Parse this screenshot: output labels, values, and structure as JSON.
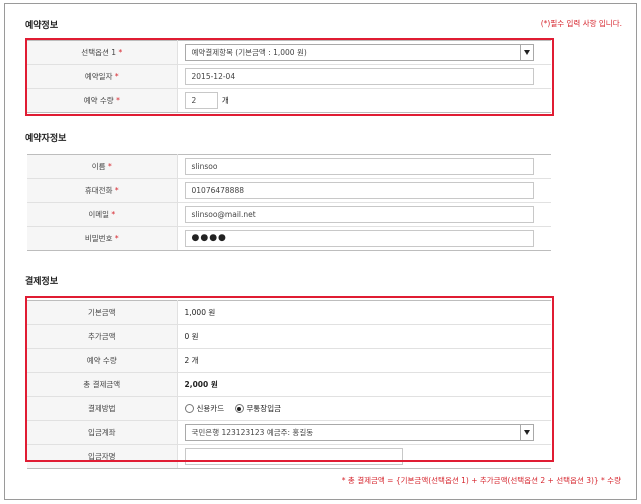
{
  "required_note": "(*)필수 입력 사항 입니다.",
  "sections": {
    "reservation_title": "예약정보",
    "reserver_title": "예약자정보",
    "payment_title": "결제정보"
  },
  "reservation": {
    "option_label": "선택옵션 1",
    "option_value": "예약결제항목 (기본금액 : 1,000 원)",
    "date_label": "예약일자",
    "date_value": "2015-12-04",
    "qty_label": "예약 수량",
    "qty_value": "2",
    "qty_unit": "개"
  },
  "reserver": {
    "name_label": "이름",
    "name_value": "slinsoo",
    "phone_label": "휴대전화",
    "phone_value": "01076478888",
    "email_label": "이메일",
    "email_value": "slinsoo@mail.net",
    "password_label": "비밀번호",
    "password_value": "●●●●"
  },
  "payment": {
    "base_label": "기본금액",
    "base_value": "1,000 원",
    "extra_label": "추가금액",
    "extra_value": "0 원",
    "qty_label": "예약 수량",
    "qty_value": "2 개",
    "total_label": "총 결제금액",
    "total_value": "2,000 원",
    "method_label": "결제방법",
    "method_card": "신용카드",
    "method_bank": "무통장입금",
    "method_selected": "무통장입금",
    "account_label": "입금계좌",
    "account_value": "국민은행 123123123 예금주: 홍길동",
    "depositor_label": "입금자명",
    "depositor_value": ""
  },
  "formula": "* 총 결제금액 = {기본금액(선택옵션 1) + 추가금액(선택옵션 2 + 선택옵션 3)} * 수량",
  "colors": {
    "accent_red": "#d6262e",
    "highlight_border": "#e01c33"
  }
}
